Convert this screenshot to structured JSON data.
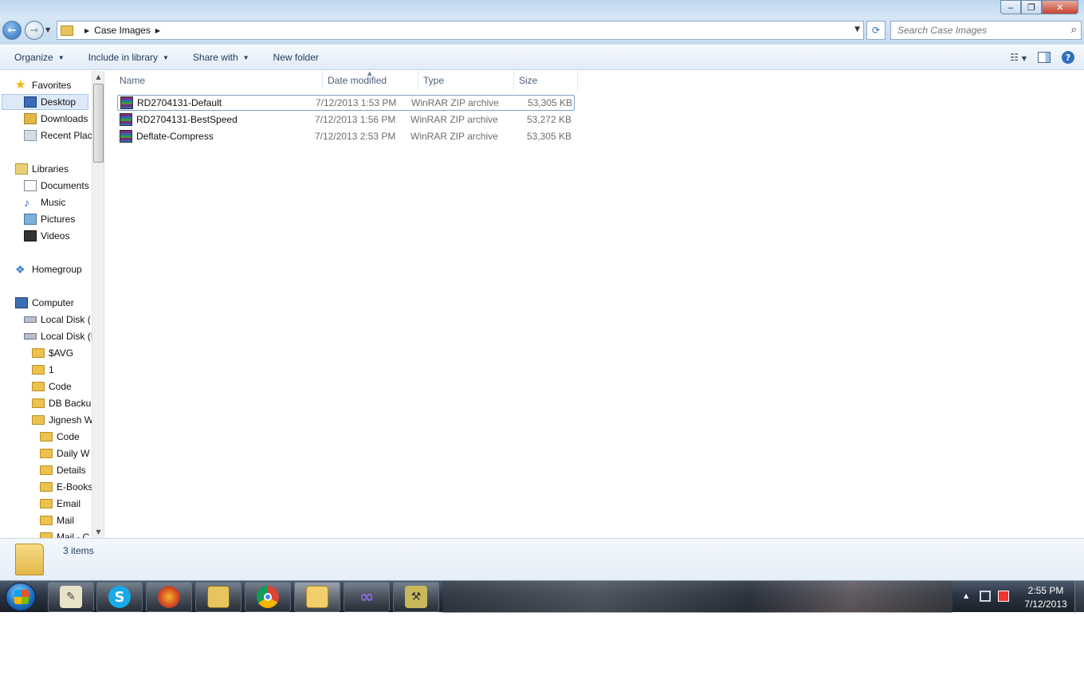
{
  "window": {
    "minimize_label": "‒",
    "maximize_label": "❐",
    "close_label": "✕"
  },
  "address": {
    "breadcrumb": "Case Images"
  },
  "search": {
    "placeholder": "Search Case Images"
  },
  "toolbar": {
    "organize": "Organize",
    "include_in_library": "Include in library",
    "share_with": "Share with",
    "new_folder": "New folder"
  },
  "sidebar": {
    "favorites": "Favorites",
    "desktop": "Desktop",
    "downloads": "Downloads",
    "recent_places": "Recent Plac",
    "libraries": "Libraries",
    "documents": "Documents",
    "music": "Music",
    "pictures": "Pictures",
    "videos": "Videos",
    "homegroup": "Homegroup",
    "computer": "Computer",
    "local_disk_c": "Local Disk (",
    "local_disk_d": "Local Disk (I",
    "folders": [
      "$AVG",
      "1",
      "Code",
      "DB Backu",
      "Jignesh W"
    ],
    "subfolders": [
      "Code",
      "Daily W",
      "Details",
      "E-Books",
      "Email",
      "Mail",
      "Mail - C"
    ]
  },
  "columns": {
    "name": "Name",
    "date_modified": "Date modified",
    "type": "Type",
    "size": "Size"
  },
  "files": [
    {
      "name": "RD2704131-Default",
      "date": "7/12/2013 1:53 PM",
      "type": "WinRAR ZIP archive",
      "size": "53,305 KB"
    },
    {
      "name": "RD2704131-BestSpeed",
      "date": "7/12/2013 1:56 PM",
      "type": "WinRAR ZIP archive",
      "size": "53,272 KB"
    },
    {
      "name": "Deflate-Compress",
      "date": "7/12/2013 2:53 PM",
      "type": "WinRAR ZIP archive",
      "size": "53,305 KB"
    }
  ],
  "details": {
    "item_count": "3 items"
  },
  "taskbar": {
    "time": "2:55 PM",
    "date": "7/12/2013",
    "apps": [
      "notepad-icon",
      "skype-icon",
      "firefox-icon",
      "outlook-icon",
      "chrome-icon",
      "explorer-icon",
      "visual-studio-icon",
      "sql-tool-icon"
    ]
  }
}
